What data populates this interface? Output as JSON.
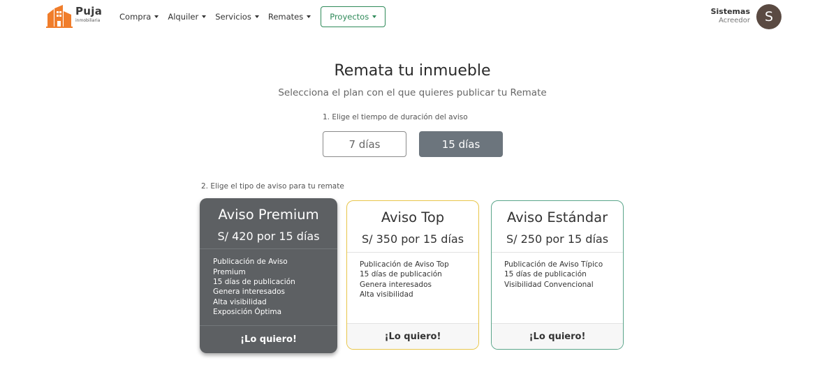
{
  "brand": {
    "name": "Puja",
    "tagline": "inmobiliaria",
    "color": "#f07d2b"
  },
  "nav": {
    "items": [
      {
        "label": "Compra"
      },
      {
        "label": "Alquiler"
      },
      {
        "label": "Servicios"
      },
      {
        "label": "Remates"
      }
    ],
    "highlight": {
      "label": "Proyectos"
    }
  },
  "user": {
    "name": "Sistemas",
    "role": "Acreedor",
    "initial": "S"
  },
  "page": {
    "title": "Remata tu inmueble",
    "subtitle": "Selecciona el plan con el que quieres publicar tu Remate",
    "step1_label": "1. Elige el tiempo de duración del aviso",
    "durations": [
      {
        "label": "7 días",
        "selected": false
      },
      {
        "label": "15 días",
        "selected": true
      }
    ],
    "step2_label": "2. Elige el tipo de aviso para tu remate"
  },
  "plans": [
    {
      "title": "Aviso Premium",
      "price": "S/ 420 por 15 días",
      "features": [
        "Publicación de Aviso",
        "Premium",
        "15 días de publicación",
        "Genera interesados",
        "Alta visibilidad",
        "Exposición Óptima"
      ],
      "cta": "¡Lo quiero!",
      "selected": true
    },
    {
      "title": "Aviso Top",
      "price": "S/ 350 por 15 días",
      "features": [
        "Publicación de Aviso Top",
        "15 días de publicación",
        "Genera interesados",
        "Alta visibilidad"
      ],
      "cta": "¡Lo quiero!",
      "border_color": "#e8c64a"
    },
    {
      "title": "Aviso Estándar",
      "price": "S/ 250 por 15 días",
      "features": [
        "Publicación de Aviso Típico",
        "15 días de publicación",
        "Visibilidad Convencional"
      ],
      "cta": "¡Lo quiero!",
      "border_color": "#5aa58a"
    }
  ]
}
